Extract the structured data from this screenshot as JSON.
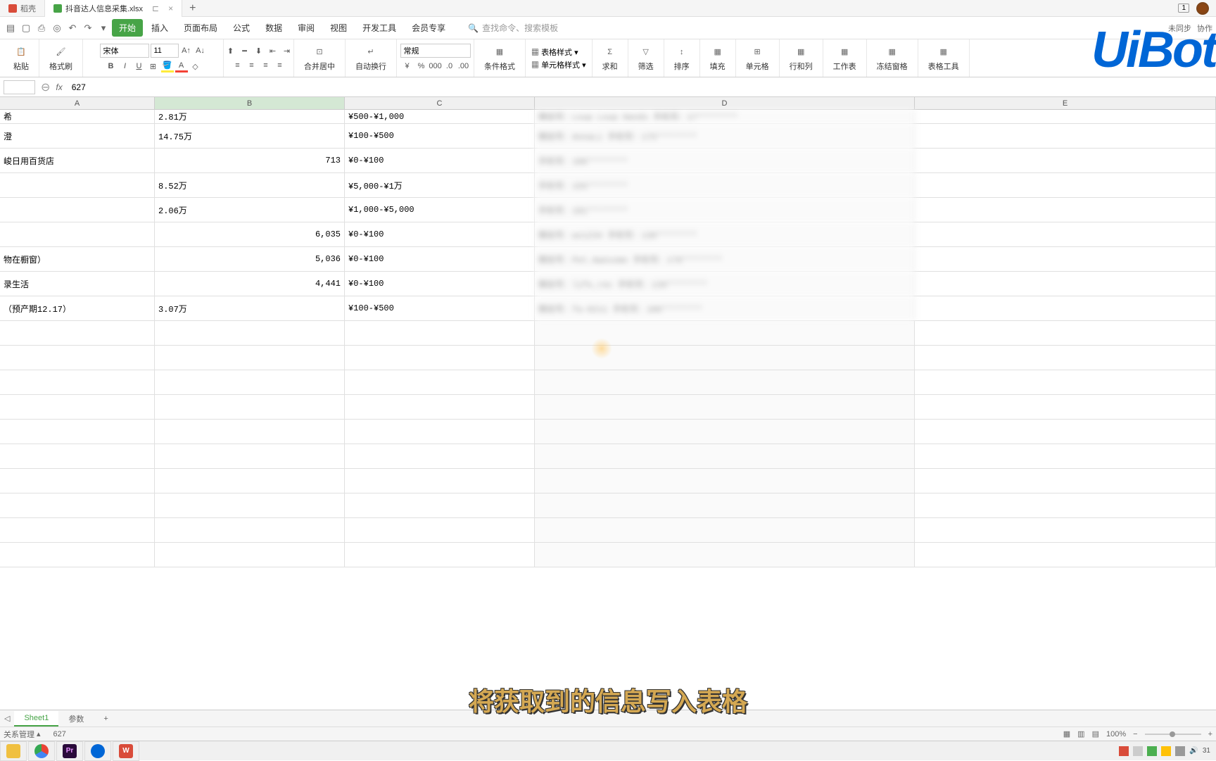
{
  "titlebar": {
    "tab1": "稻壳",
    "tab2": "抖音达人信息采集.xlsx",
    "badge": "1"
  },
  "menu": {
    "start": "开始",
    "insert": "插入",
    "layout": "页面布局",
    "formula": "公式",
    "data": "数据",
    "review": "审阅",
    "view": "视图",
    "dev": "开发工具",
    "member": "会员专享",
    "searchPlaceholder": "查找命令、搜索模板",
    "sync": "未同步",
    "coop": "协作"
  },
  "ribbon": {
    "paste": "粘贴",
    "format": "格式刷",
    "font": "宋体",
    "size": "11",
    "merge": "合并居中",
    "wrap": "自动换行",
    "numfmt": "常规",
    "condfmt": "条件格式",
    "tablestyle": "表格样式",
    "cellstyle": "单元格样式",
    "sum": "求和",
    "filter": "筛选",
    "sort": "排序",
    "fill": "填充",
    "cell": "单元格",
    "rowcol": "行和列",
    "sheet": "工作表",
    "freeze": "冻结窗格",
    "tabletools": "表格工具"
  },
  "formula": {
    "value": "627"
  },
  "columns": [
    "A",
    "B",
    "C",
    "D",
    "E"
  ],
  "rows": [
    {
      "a": "希",
      "b": "2.81万",
      "c": "¥500-¥1,000",
      "d": "微信号：Loup Loup Hands 手机号：17********"
    },
    {
      "a": "澄",
      "b": "14.75万",
      "c": "¥100-¥500",
      "d": "微信号：AnnaLi 手机号：175********"
    },
    {
      "a": "峻日用百货店",
      "b": "713",
      "c": "¥0-¥100",
      "d": "手机号：186********"
    },
    {
      "a": "",
      "b": "8.52万",
      "c": "¥5,000-¥1万",
      "d": "手机号：155********"
    },
    {
      "a": "",
      "b": "2.06万",
      "c": "¥1,000-¥5,000",
      "d": "手机号：181********"
    },
    {
      "a": "",
      "b": "6,035",
      "c": "¥0-¥100",
      "d": "微信号：wx1234 手机号：130********"
    },
    {
      "a": "物在橱窗）",
      "b": "5,036",
      "c": "¥0-¥100",
      "d": "微信号：Pet.Awesome 手机号：178********"
    },
    {
      "a": "录生活",
      "b": "4,441",
      "c": "¥0-¥100",
      "d": "微信号：life_rec 手机号：139********"
    },
    {
      "a": "（预产期12.17）",
      "b": "3.07万",
      "c": "¥100-¥500",
      "d": "微信号：fa-0211 手机号：188********"
    }
  ],
  "sheets": {
    "tab1": "",
    "tab2": "Sheet1",
    "tab3": "参数"
  },
  "status": {
    "left": "关系管理",
    "value": "627",
    "zoom": "100%"
  },
  "subtitle": "将获取到的信息写入表格",
  "logo": "UiBot",
  "taskbar": {
    "time": "31"
  }
}
